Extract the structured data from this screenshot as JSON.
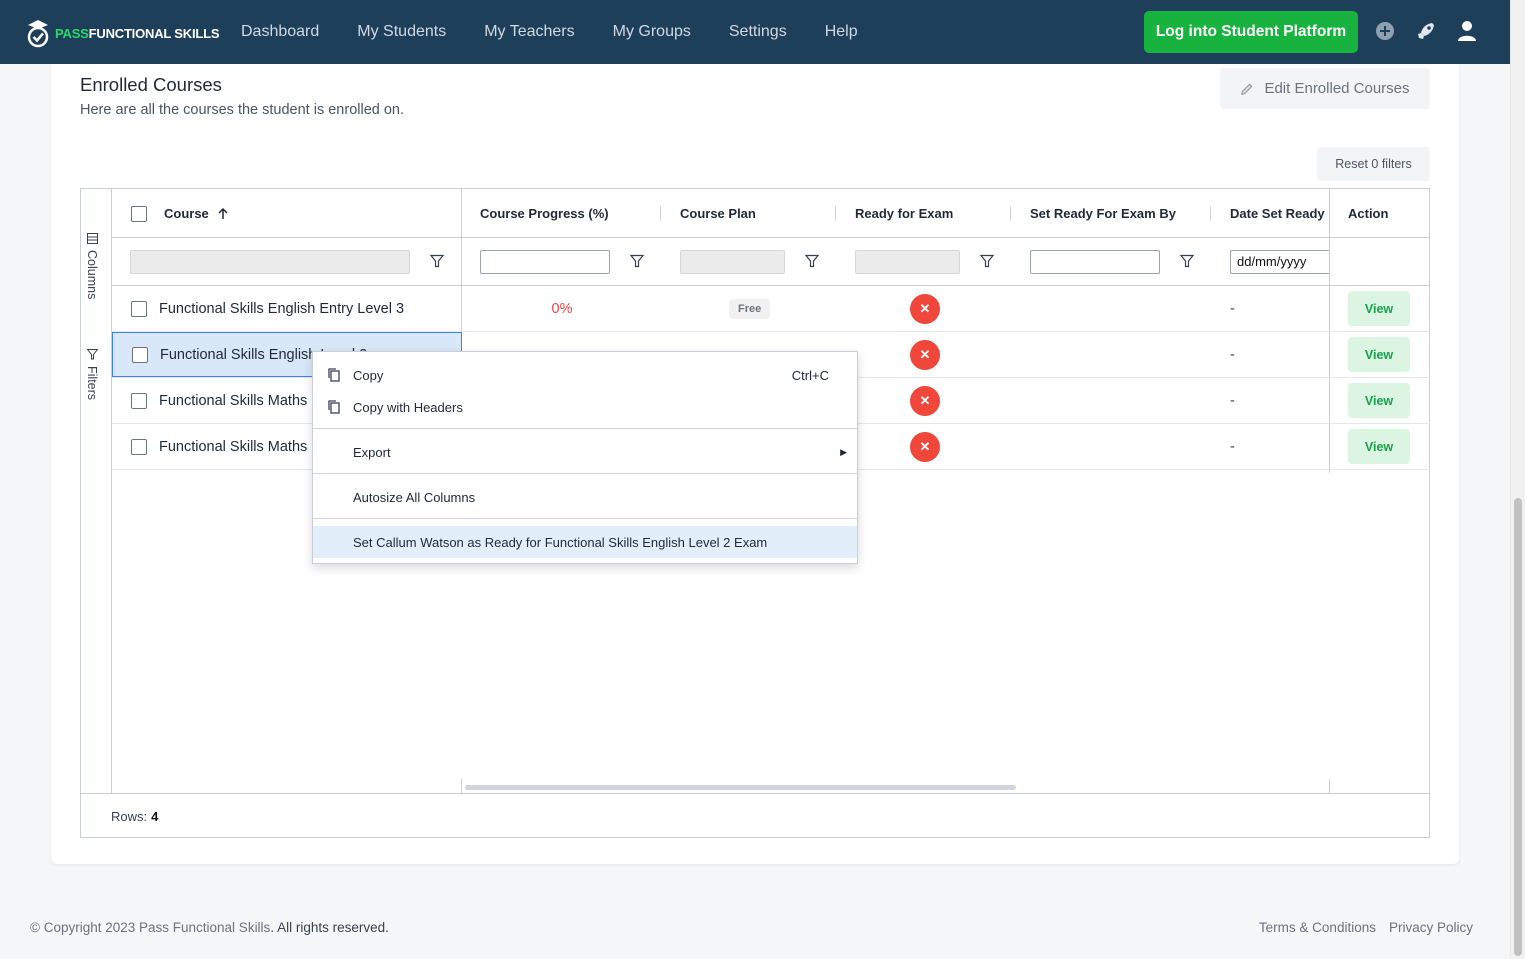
{
  "brand": {
    "pass": "PASS",
    "rest": "FUNCTIONAL SKILLS"
  },
  "nav": {
    "links": [
      "Dashboard",
      "My Students",
      "My Teachers",
      "My Groups",
      "Settings",
      "Help"
    ],
    "student_platform_button": "Log into Student Platform",
    "icons": [
      "plus-circle-icon",
      "rocket-icon",
      "user-icon"
    ]
  },
  "card": {
    "title": "Enrolled Courses",
    "subtitle": "Here are all the courses the student is enrolled on.",
    "edit_button": "Edit Enrolled Courses",
    "reset_button": "Reset 0 filters"
  },
  "grid": {
    "side_tabs": {
      "columns": "Columns",
      "filters": "Filters"
    },
    "columns": [
      "Course",
      "Course Progress (%)",
      "Course Plan",
      "Ready for Exam",
      "Set Ready For Exam By",
      "Date Set Ready",
      "Action"
    ],
    "sort": {
      "column": "Course",
      "direction": "ascending"
    },
    "filters": {
      "date_placeholder": "dd/mm/yyyy"
    },
    "rows": [
      {
        "course": "Functional Skills English Entry Level 3",
        "progress": "0%",
        "plan": "Free",
        "ready": "✕",
        "set_by": "",
        "date": "-",
        "action": "View"
      },
      {
        "course": "Functional Skills English Level 2",
        "progress": "",
        "plan": "",
        "ready": "✕",
        "set_by": "",
        "date": "-",
        "action": "View"
      },
      {
        "course": "Functional Skills Maths",
        "progress": "",
        "plan": "",
        "ready": "✕",
        "set_by": "",
        "date": "-",
        "action": "View"
      },
      {
        "course": "Functional Skills Maths",
        "progress": "",
        "plan": "",
        "ready": "✕",
        "set_by": "",
        "date": "-",
        "action": "View"
      }
    ],
    "selected_row": 1,
    "footer": {
      "label": "Rows:",
      "count": "4"
    }
  },
  "context_menu": {
    "copy": "Copy",
    "copy_shortcut": "Ctrl+C",
    "copy_headers": "Copy with Headers",
    "export": "Export",
    "autosize": "Autosize All Columns",
    "set_ready": "Set Callum Watson as Ready for Functional Skills English Level 2 Exam"
  },
  "footer": {
    "copyright_prefix": "© Copyright 2023 Pass Functional Skills",
    "copyright_suffix": ". All rights reserved.",
    "links": [
      "Terms & Conditions",
      "Privacy Policy"
    ]
  },
  "colors": {
    "nav_bg": "#1e3f5a",
    "brand_green": "#17b33e",
    "error_red": "#f0473a",
    "view_green": "#16a34a"
  }
}
